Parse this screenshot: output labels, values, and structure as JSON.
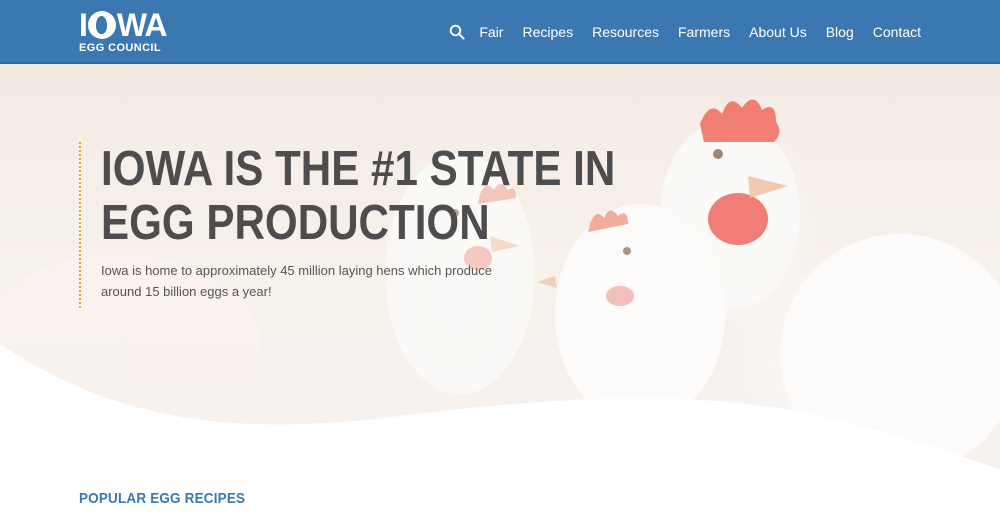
{
  "brand": {
    "logo_mark_text": "IOWA",
    "logo_subtext": "EGG COUNCIL"
  },
  "nav": {
    "search_icon": "search-icon",
    "items": [
      "Fair",
      "Recipes",
      "Resources",
      "Farmers",
      "About Us",
      "Blog",
      "Contact"
    ]
  },
  "hero": {
    "title": "IOWA IS THE #1 STATE IN EGG PRODUCTION",
    "description": "Iowa is home to approximately 45 million laying hens which produce around 15 billion eggs a year!"
  },
  "sections": {
    "popular_recipes_title": "POPULAR EGG RECIPES"
  },
  "colors": {
    "header_bg": "#3b78b2",
    "accent_blue": "#3b78b2",
    "hero_border": "#e3a33a",
    "title_text": "#4d4d4d"
  }
}
